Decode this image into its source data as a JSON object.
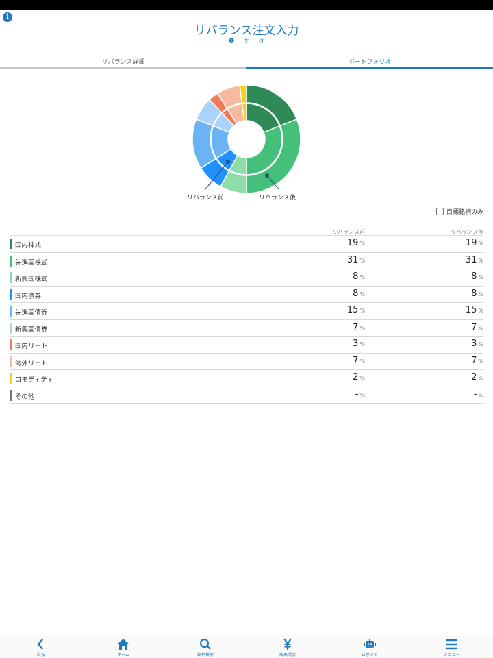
{
  "header": {
    "title": "リバランス注文入力",
    "steps": [
      "❶",
      "②",
      "③"
    ]
  },
  "tabs": [
    {
      "label": "リバランス詳細",
      "active": false
    },
    {
      "label": "ポートフォリオ",
      "active": true
    }
  ],
  "chart_data": {
    "type": "pie",
    "variant": "double-donut",
    "series": [
      {
        "name": "リバランス前",
        "ring": "inner",
        "values": [
          19,
          31,
          8,
          8,
          15,
          7,
          3,
          7,
          2,
          0
        ]
      },
      {
        "name": "リバランス後",
        "ring": "outer",
        "values": [
          19,
          31,
          8,
          8,
          15,
          7,
          3,
          7,
          2,
          0
        ]
      }
    ],
    "categories": [
      "国内株式",
      "先進国株式",
      "新興国株式",
      "国内債券",
      "先進国債券",
      "新興国債券",
      "国内リート",
      "海外リート",
      "コモディティ",
      "その他"
    ],
    "colors": [
      "#2e8b57",
      "#45c07a",
      "#8fdcab",
      "#1e90ff",
      "#6ab4f5",
      "#a9d3fb",
      "#f27a56",
      "#f7b9a0",
      "#f5cf1c",
      "#777777"
    ]
  },
  "labels": {
    "before": "リバランス前",
    "after": "リバランス後"
  },
  "filter": {
    "label": "目標銘柄のみ",
    "checked": false
  },
  "table": {
    "header_before": "リバランス前",
    "header_after": "リバランス後",
    "unit": "%",
    "rows": [
      {
        "name": "国内株式",
        "color": "#2e8b57",
        "before": "19",
        "after": "19"
      },
      {
        "name": "先進国株式",
        "color": "#45c07a",
        "before": "31",
        "after": "31"
      },
      {
        "name": "新興国株式",
        "color": "#8fdcab",
        "before": "8",
        "after": "8"
      },
      {
        "name": "国内債券",
        "color": "#1e90ff",
        "before": "8",
        "after": "8"
      },
      {
        "name": "先進国債券",
        "color": "#6ab4f5",
        "before": "15",
        "after": "15"
      },
      {
        "name": "新興国債券",
        "color": "#a9d3fb",
        "before": "7",
        "after": "7"
      },
      {
        "name": "国内リート",
        "color": "#f27a56",
        "before": "3",
        "after": "3"
      },
      {
        "name": "海外リート",
        "color": "#f7b9a0",
        "before": "7",
        "after": "7"
      },
      {
        "name": "コモディティ",
        "color": "#f5cf1c",
        "before": "2",
        "after": "2"
      },
      {
        "name": "その他",
        "color": "#777777",
        "before": "-",
        "after": "-"
      }
    ]
  },
  "bottom_nav": [
    {
      "label": "戻る",
      "icon": "back-icon"
    },
    {
      "label": "ホーム",
      "icon": "home-icon"
    },
    {
      "label": "銘柄検索",
      "icon": "search-icon"
    },
    {
      "label": "残高照会",
      "icon": "yen-icon"
    },
    {
      "label": "ロボアド",
      "icon": "robot-icon"
    },
    {
      "label": "メニュー",
      "icon": "menu-icon"
    }
  ]
}
